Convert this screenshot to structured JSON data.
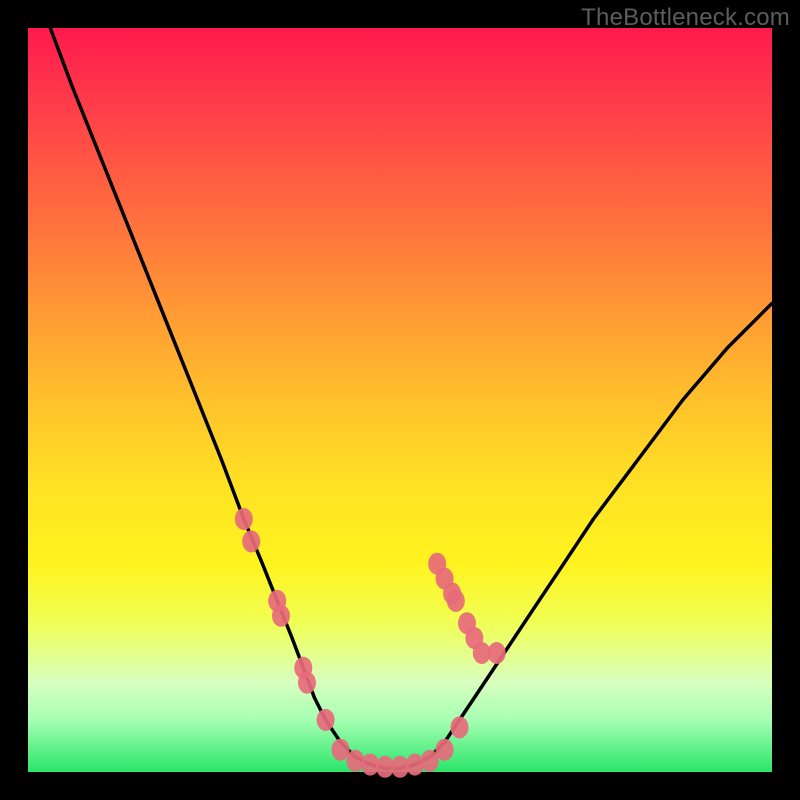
{
  "watermark": "TheBottleneck.com",
  "gradient": {
    "top": "#ff1a4d",
    "bottom": "#29e56a"
  },
  "chart_data": {
    "type": "line",
    "title": "",
    "xlabel": "",
    "ylabel": "",
    "xlim": [
      0,
      100
    ],
    "ylim": [
      0,
      100
    ],
    "grid": false,
    "series": [
      {
        "name": "bottleneck-curve",
        "x": [
          3,
          6,
          10,
          14,
          18,
          22,
          26,
          29,
          31.5,
          33.5,
          35.5,
          37,
          38.5,
          40,
          42,
          44,
          46,
          48,
          50,
          52,
          54,
          56,
          58,
          60,
          64,
          68,
          72,
          76,
          82,
          88,
          94,
          100
        ],
        "y": [
          100,
          92,
          82,
          72,
          62,
          52,
          42,
          34,
          28,
          23,
          18,
          14,
          10,
          7,
          4,
          2,
          1,
          0.5,
          0.5,
          1,
          2,
          4,
          7,
          10,
          16,
          22,
          28,
          34,
          42,
          50,
          57,
          63
        ]
      }
    ],
    "markers": [
      {
        "name": "left-cluster",
        "color": "#e76a7b",
        "points": [
          [
            29,
            34
          ],
          [
            30,
            31
          ],
          [
            33.5,
            23
          ],
          [
            34,
            21
          ],
          [
            37,
            14
          ],
          [
            37.5,
            12
          ],
          [
            40,
            7
          ]
        ]
      },
      {
        "name": "bottom-cluster",
        "color": "#e76a7b",
        "points": [
          [
            42,
            3
          ],
          [
            44,
            1.5
          ],
          [
            46,
            1
          ],
          [
            48,
            0.7
          ],
          [
            50,
            0.7
          ],
          [
            52,
            1
          ],
          [
            54,
            1.5
          ],
          [
            56,
            3
          ],
          [
            58,
            6
          ]
        ]
      },
      {
        "name": "right-cluster",
        "color": "#e76a7b",
        "points": [
          [
            55,
            28
          ],
          [
            56,
            26
          ],
          [
            57,
            24
          ],
          [
            57.5,
            23
          ],
          [
            59,
            20
          ],
          [
            60,
            18
          ],
          [
            61,
            16
          ],
          [
            63,
            16
          ]
        ]
      }
    ]
  }
}
